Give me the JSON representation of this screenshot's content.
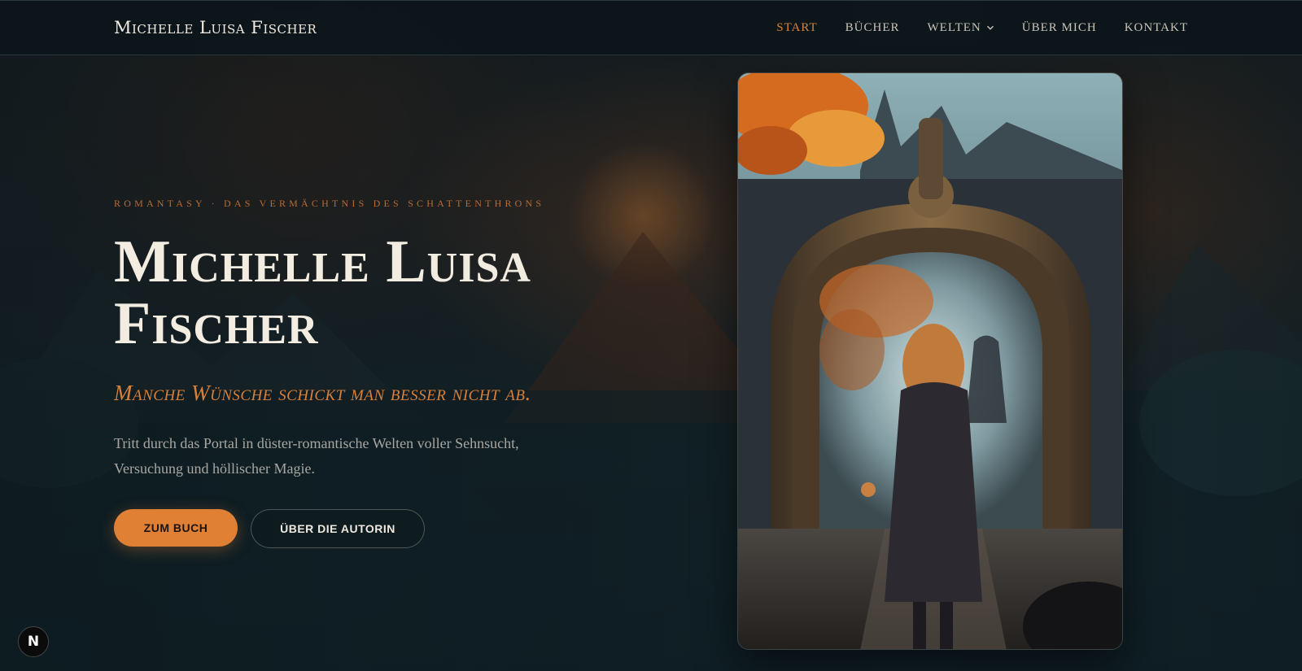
{
  "header": {
    "brand": "Michelle Luisa Fischer",
    "nav": [
      {
        "label": "START",
        "active": true
      },
      {
        "label": "BÜCHER",
        "active": false
      },
      {
        "label": "WELTEN",
        "active": false,
        "has_dropdown": true
      },
      {
        "label": "ÜBER MICH",
        "active": false
      },
      {
        "label": "KONTAKT",
        "active": false
      }
    ]
  },
  "hero": {
    "eyebrow": "ROMANTASY · DAS VERMÄCHTNIS DES SCHATTENTHRONS",
    "title_line1": "Michelle Luisa",
    "title_line2": "Fischer",
    "tagline": "Manche Wünsche schickt man besser nicht ab.",
    "lead": "Tritt durch das Portal in düster-romantische Welten voller Sehnsucht, Versuchung und höllischer Magie.",
    "primary_button": "ZUM BUCH",
    "secondary_button": "ÜBER DIE AUTORIN"
  },
  "cover_image": {
    "icon": "ornate-portal-illustration"
  },
  "dev_badge": {
    "label": "N",
    "icon": "nextjs-badge-icon"
  },
  "colors": {
    "accent": "#df8035",
    "background": "#0f1a1f",
    "text": "#f3ece0"
  }
}
